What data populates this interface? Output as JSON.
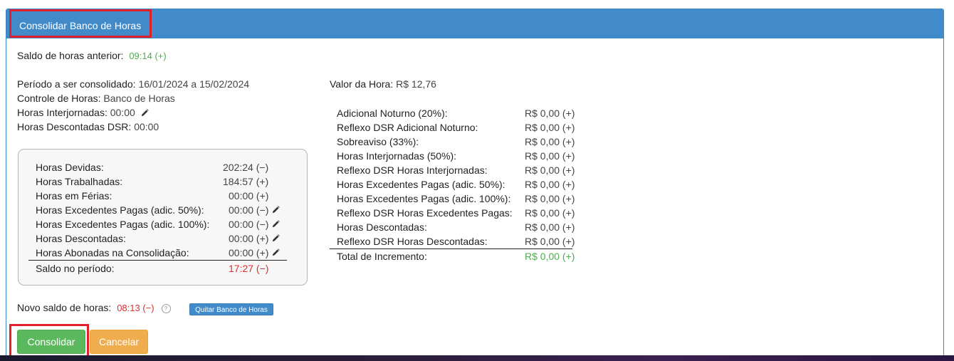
{
  "header": {
    "title": "Consolidar Banco de Horas"
  },
  "saldo_anterior": {
    "label": "Saldo de horas anterior:",
    "value": "09:14 (+)"
  },
  "info": {
    "periodo_label": "Período a ser consolidado:",
    "periodo_value": "16/01/2024 a 15/02/2024",
    "controle_label": "Controle de Horas:",
    "controle_value": "Banco de Horas",
    "interjornadas_label": "Horas Interjornadas:",
    "interjornadas_value": "00:00",
    "dsr_label": "Horas Descontadas DSR:",
    "dsr_value": "00:00",
    "valor_hora_label": "Valor da Hora:",
    "valor_hora_value": "R$ 12,76"
  },
  "summary": {
    "rows": [
      {
        "label": "Horas Devidas:",
        "value": "202:24 (−)"
      },
      {
        "label": "Horas Trabalhadas:",
        "value": "184:57 (+)"
      },
      {
        "label": "Horas em Férias:",
        "value": "00:00 (+)"
      },
      {
        "label": "Horas Excedentes Pagas (adic. 50%):",
        "value": "00:00 (−)"
      },
      {
        "label": "Horas Excedentes Pagas (adic. 100%):",
        "value": "00:00 (−)"
      },
      {
        "label": "Horas Descontadas:",
        "value": "00:00 (+)"
      },
      {
        "label": "Horas Abonadas na Consolidação:",
        "value": "00:00 (+)"
      }
    ],
    "saldo_label": "Saldo no período:",
    "saldo_value": "17:27 (−)"
  },
  "increments": {
    "rows": [
      {
        "label": "Adicional Noturno (20%):",
        "value": "R$ 0,00 (+)"
      },
      {
        "label": "Reflexo DSR Adicional Noturno:",
        "value": "R$ 0,00 (+)"
      },
      {
        "label": "Sobreaviso (33%):",
        "value": "R$ 0,00 (+)"
      },
      {
        "label": "Horas Interjornadas (50%):",
        "value": "R$ 0,00 (+)"
      },
      {
        "label": "Reflexo DSR Horas Interjornadas:",
        "value": "R$ 0,00 (+)"
      },
      {
        "label": "Horas Excedentes Pagas (adic. 50%):",
        "value": "R$ 0,00 (+)"
      },
      {
        "label": "Horas Excedentes Pagas (adic. 100%):",
        "value": "R$ 0,00 (+)"
      },
      {
        "label": "Reflexo DSR Horas Excedentes Pagas:",
        "value": "R$ 0,00 (+)"
      },
      {
        "label": "Horas Descontadas:",
        "value": "R$ 0,00 (+)"
      },
      {
        "label": "Reflexo DSR Horas Descontadas:",
        "value": "R$ 0,00 (+)"
      }
    ],
    "total_label": "Total de Incremento:",
    "total_value": "R$ 0,00 (+)"
  },
  "novo_saldo": {
    "label": "Novo saldo de horas:",
    "value": "08:13 (−)",
    "help": "?"
  },
  "buttons": {
    "quitar": "Quitar Banco de Horas",
    "consolidar": "Consolidar",
    "cancelar": "Cancelar"
  },
  "colors": {
    "primary": "#428bca",
    "success": "#5cb85c",
    "warning": "#f0ad4e",
    "positive": "#4cae4c",
    "negative": "#d9302f",
    "highlight": "#e0202a"
  }
}
